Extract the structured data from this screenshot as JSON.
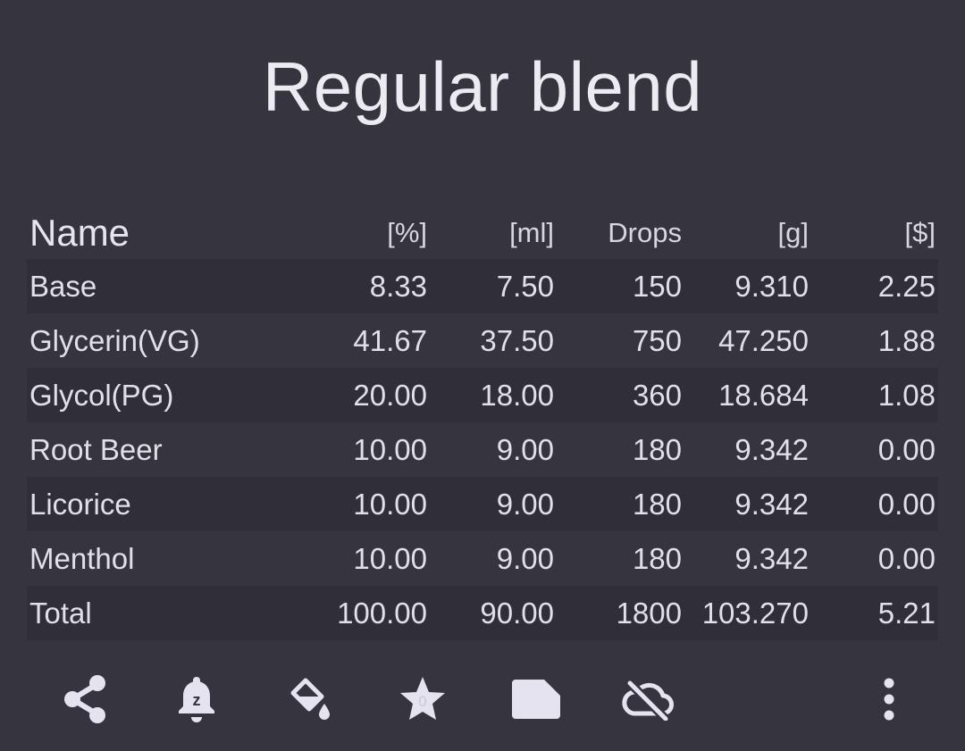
{
  "title": "Regular blend",
  "columns": {
    "name": "Name",
    "percent": "[%]",
    "ml": "[ml]",
    "drops": "Drops",
    "grams": "[g]",
    "cost": "[$]"
  },
  "rows": [
    {
      "name": "Base",
      "percent": "8.33",
      "ml": "7.50",
      "drops": "150",
      "grams": "9.310",
      "cost": "2.25"
    },
    {
      "name": "Glycerin(VG)",
      "percent": "41.67",
      "ml": "37.50",
      "drops": "750",
      "grams": "47.250",
      "cost": "1.88"
    },
    {
      "name": "Glycol(PG)",
      "percent": "20.00",
      "ml": "18.00",
      "drops": "360",
      "grams": "18.684",
      "cost": "1.08"
    },
    {
      "name": "Root Beer",
      "percent": "10.00",
      "ml": "9.00",
      "drops": "180",
      "grams": "9.342",
      "cost": "0.00"
    },
    {
      "name": "Licorice",
      "percent": "10.00",
      "ml": "9.00",
      "drops": "180",
      "grams": "9.342",
      "cost": "0.00"
    },
    {
      "name": "Menthol",
      "percent": "10.00",
      "ml": "9.00",
      "drops": "180",
      "grams": "9.342",
      "cost": "0.00"
    },
    {
      "name": "Total",
      "percent": "100.00",
      "ml": "90.00",
      "drops": "1800",
      "grams": "103.270",
      "cost": "5.21"
    }
  ],
  "toolbar": {
    "icons": [
      "share-icon",
      "snooze-alarm-icon",
      "paint-bucket-icon",
      "star-icon",
      "note-icon",
      "cloud-off-icon",
      "more-vert-icon"
    ],
    "star_badge": "0",
    "snooze_badge": "z"
  },
  "colors": {
    "background": "#35343f",
    "stripe": "#2f2e39",
    "text": "#e1e0e8",
    "icon": "#e4e3ef"
  }
}
